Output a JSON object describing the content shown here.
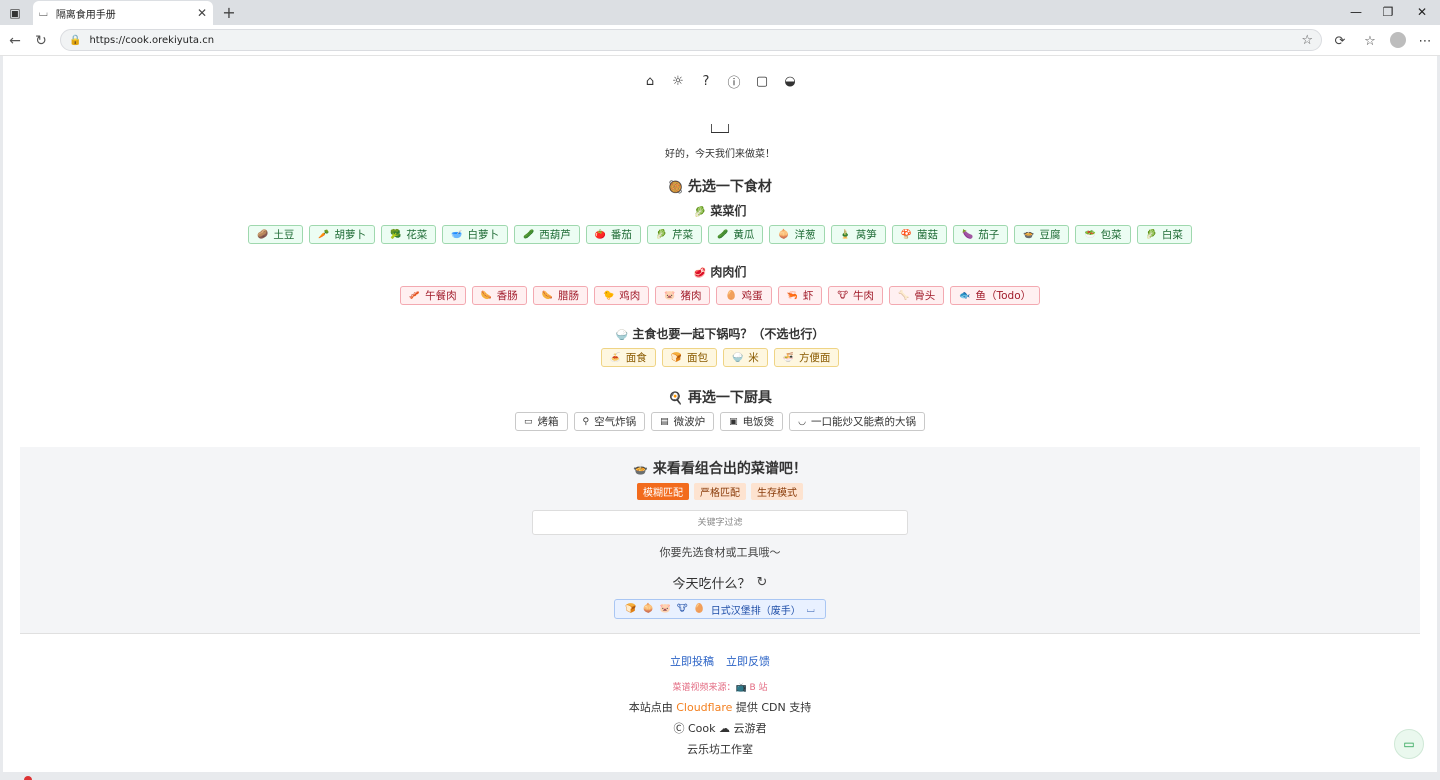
{
  "browser": {
    "tab_title": "隔离食用手册",
    "url": "https://cook.orekiyuta.cn"
  },
  "header": {
    "subtitle": "好的，今天我们来做菜！"
  },
  "ingredients": {
    "title": "先选一下食材",
    "title_emoji": "🥘",
    "veg_title": "菜菜们",
    "veg_emoji": "🥬",
    "veg": [
      {
        "emoji": "🥔",
        "label": "土豆"
      },
      {
        "emoji": "🥕",
        "label": "胡萝卜"
      },
      {
        "emoji": "🥦",
        "label": "花菜"
      },
      {
        "emoji": "🥣",
        "label": "白萝卜"
      },
      {
        "emoji": "🥒",
        "label": "西葫芦"
      },
      {
        "emoji": "🍅",
        "label": "番茄"
      },
      {
        "emoji": "🥬",
        "label": "芹菜"
      },
      {
        "emoji": "🥒",
        "label": "黄瓜"
      },
      {
        "emoji": "🧅",
        "label": "洋葱"
      },
      {
        "emoji": "🎍",
        "label": "莴笋"
      },
      {
        "emoji": "🍄",
        "label": "菌菇"
      },
      {
        "emoji": "🍆",
        "label": "茄子"
      },
      {
        "emoji": "🍲",
        "label": "豆腐"
      },
      {
        "emoji": "🥗",
        "label": "包菜"
      },
      {
        "emoji": "🥬",
        "label": "白菜"
      }
    ],
    "meat_title": "肉肉们",
    "meat_emoji": "🥩",
    "meat": [
      {
        "emoji": "🥓",
        "label": "午餐肉"
      },
      {
        "emoji": "🌭",
        "label": "香肠"
      },
      {
        "emoji": "🌭",
        "label": "腊肠"
      },
      {
        "emoji": "🐤",
        "label": "鸡肉"
      },
      {
        "emoji": "🐷",
        "label": "猪肉"
      },
      {
        "emoji": "🥚",
        "label": "鸡蛋"
      },
      {
        "emoji": "🦐",
        "label": "虾"
      },
      {
        "emoji": "🐮",
        "label": "牛肉"
      },
      {
        "emoji": "🦴",
        "label": "骨头"
      },
      {
        "emoji": "🐟",
        "label": "鱼（Todo）"
      }
    ],
    "staple_title": "主食也要一起下锅吗？（不选也行）",
    "staple_emoji": "🍚",
    "staple": [
      {
        "emoji": "🍝",
        "label": "面食"
      },
      {
        "emoji": "🍞",
        "label": "面包"
      },
      {
        "emoji": "🍚",
        "label": "米"
      },
      {
        "emoji": "🍜",
        "label": "方便面"
      }
    ]
  },
  "tools": {
    "title": "再选一下厨具",
    "title_emoji": "🍳",
    "items": [
      {
        "icon": "oven-icon",
        "glyph": "▭",
        "label": "烤箱"
      },
      {
        "icon": "air-fryer-icon",
        "glyph": "⚲",
        "label": "空气炸锅"
      },
      {
        "icon": "microwave-icon",
        "glyph": "▤",
        "label": "微波炉"
      },
      {
        "icon": "rice-cooker-icon",
        "glyph": "▣",
        "label": "电饭煲"
      },
      {
        "icon": "pot-icon",
        "glyph": "◡",
        "label": "一口能炒又能煮的大锅"
      }
    ]
  },
  "results": {
    "title": "来看看组合出的菜谱吧！",
    "title_emoji": "🍲",
    "modes": [
      {
        "label": "模糊匹配",
        "active": true
      },
      {
        "label": "严格匹配",
        "active": false
      },
      {
        "label": "生存模式",
        "active": false
      }
    ],
    "search_placeholder": "关键字过滤",
    "hint": "你要先选食材或工具哦～",
    "today_label": "今天吃什么？",
    "recipe": {
      "emojis": [
        "🍞",
        "🧅",
        "🐷",
        "🐮",
        "🥚"
      ],
      "label": "日式汉堡排（废手）"
    }
  },
  "footer": {
    "links": [
      "立即投稿",
      "立即反馈"
    ],
    "video_source": "菜谱视频来源：📺 B 站",
    "cdn_prefix": "本站点由",
    "cdn_name": "Cloudflare",
    "cdn_suffix": "提供 CDN 支持",
    "cook_line": "Ⓒ Cook ☁ 云游君",
    "studio": "云乐坊工作室"
  },
  "colors": {
    "accent": "#f26b1d",
    "veg_border": "#9fd8ae",
    "meat_border": "#f3a9b1",
    "staple_border": "#efd485",
    "link": "#2b63c6"
  }
}
